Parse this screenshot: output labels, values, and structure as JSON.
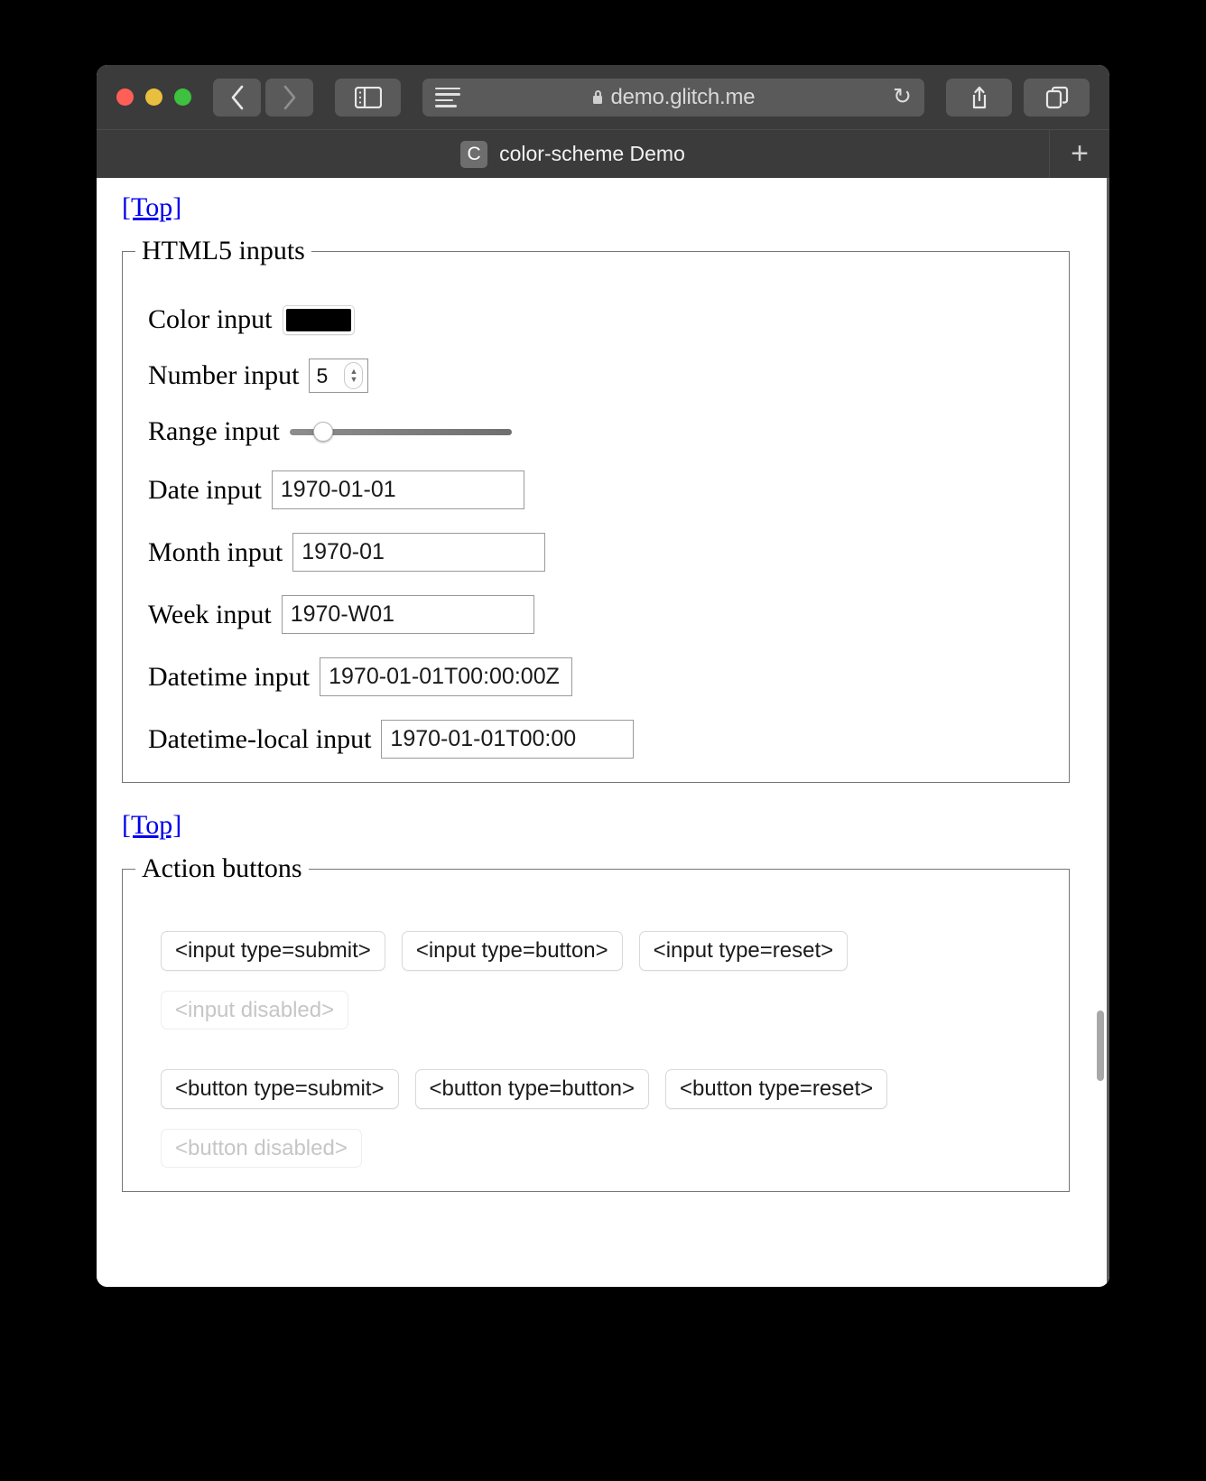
{
  "browser": {
    "traffic_lights": [
      "close",
      "minimize",
      "zoom"
    ],
    "back_label": "‹",
    "forward_label": "›",
    "url": "demo.glitch.me",
    "reload_label": "↻",
    "newtab_label": "+",
    "tab": {
      "favicon_letter": "C",
      "title": "color-scheme Demo"
    }
  },
  "page": {
    "top_link_1": "[Top]",
    "top_link_2": "[Top]",
    "inputs_fieldset": {
      "legend": "HTML5 inputs",
      "fields": [
        {
          "label": "Color input",
          "type": "color",
          "value": "#000000"
        },
        {
          "label": "Number input",
          "type": "number",
          "value": "5"
        },
        {
          "label": "Range input",
          "type": "range",
          "value": "10"
        },
        {
          "label": "Date input",
          "type": "date",
          "value": "1970-01-01"
        },
        {
          "label": "Month input",
          "type": "month",
          "value": "1970-01"
        },
        {
          "label": "Week input",
          "type": "week",
          "value": "1970-W01"
        },
        {
          "label": "Datetime input",
          "type": "datetime",
          "value": "1970-01-01T00:00:00Z"
        },
        {
          "label": "Datetime-local input",
          "type": "datetime-local",
          "value": "1970-01-01T00:00"
        }
      ]
    },
    "buttons_fieldset": {
      "legend": "Action buttons",
      "input_row": [
        "<input type=submit>",
        "<input type=button>",
        "<input type=reset>"
      ],
      "input_disabled": "<input disabled>",
      "button_row": [
        "<button type=submit>",
        "<button type=button>",
        "<button type=reset>"
      ],
      "button_disabled": "<button disabled>"
    }
  },
  "colors": {
    "link": "#0000ee",
    "toolbar_bg": "#3b3b3b",
    "page_bg": "#ffffff",
    "color_input_value": "#000000"
  }
}
